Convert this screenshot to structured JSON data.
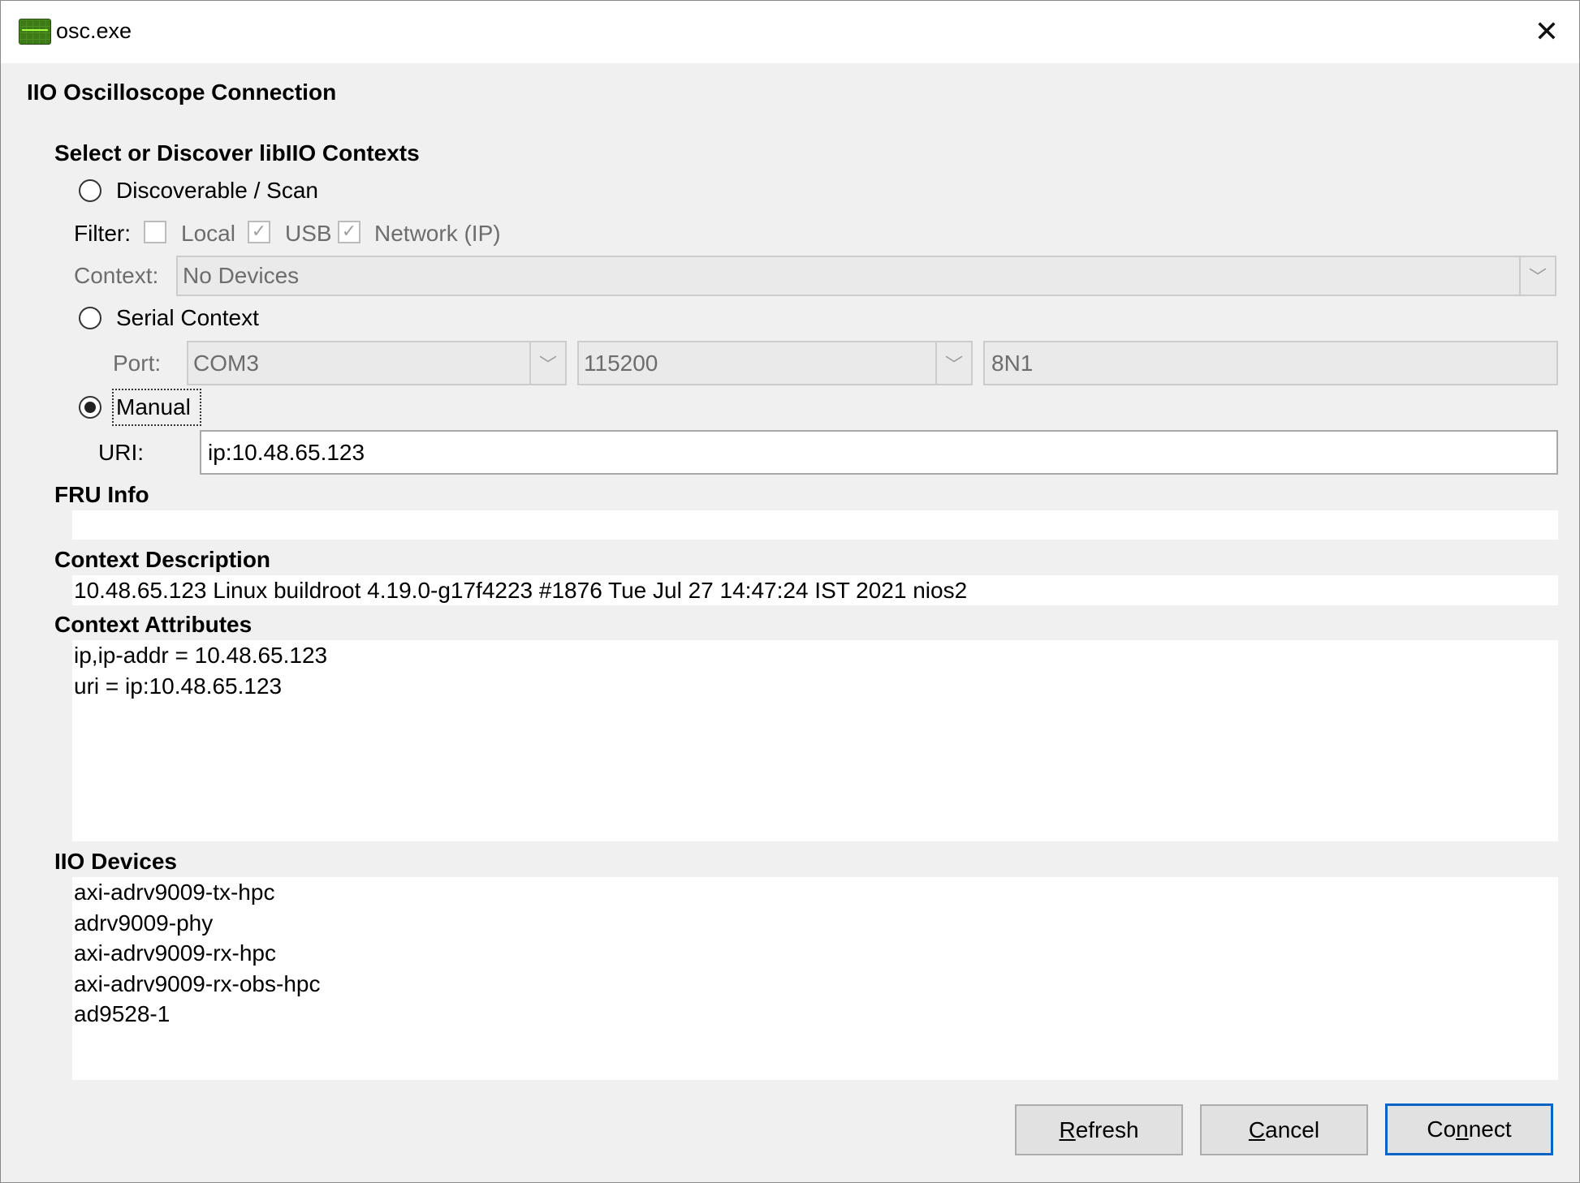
{
  "window": {
    "title": "osc.exe",
    "close_glyph": "✕"
  },
  "dialog": {
    "heading": "IIO Oscilloscope Connection"
  },
  "contexts": {
    "heading": "Select or Discover libIIO Contexts",
    "discoverable": {
      "label": "Discoverable / Scan",
      "selected": false
    },
    "filter": {
      "label": "Filter:",
      "local": {
        "label": "Local",
        "checked": false
      },
      "usb": {
        "label": "USB",
        "checked": true
      },
      "network": {
        "label": "Network (IP)",
        "checked": true
      }
    },
    "context_select": {
      "label": "Context:",
      "value": "No Devices"
    },
    "serial": {
      "label": "Serial Context",
      "selected": false,
      "port_label": "Port:",
      "port": "COM3",
      "baud": "115200",
      "config": "8N1"
    },
    "manual": {
      "label": "Manual",
      "selected": true,
      "uri_label": "URI:",
      "uri": "ip:10.48.65.123"
    }
  },
  "fru_info": {
    "heading": "FRU Info",
    "value": ""
  },
  "context_description": {
    "heading": "Context Description",
    "value": "10.48.65.123 Linux buildroot 4.19.0-g17f4223 #1876 Tue Jul 27 14:47:24 IST 2021 nios2"
  },
  "context_attributes": {
    "heading": "Context Attributes",
    "lines": [
      "ip,ip-addr = 10.48.65.123",
      "uri = ip:10.48.65.123"
    ]
  },
  "iio_devices": {
    "heading": "IIO Devices",
    "items": [
      "axi-adrv9009-tx-hpc",
      "adrv9009-phy",
      "axi-adrv9009-rx-hpc",
      "axi-adrv9009-rx-obs-hpc",
      "ad9528-1"
    ]
  },
  "buttons": {
    "refresh": {
      "label": "Refresh",
      "mnemonic_index": 0
    },
    "cancel": {
      "label": "Cancel",
      "mnemonic_index": 0
    },
    "connect": {
      "label": "Connect",
      "mnemonic_index": 2
    }
  },
  "icons": {
    "app": "oscilloscope-app-icon",
    "close": "close-icon",
    "dropdown": "chevron-down-icon",
    "check": "checkmark-icon"
  },
  "colors": {
    "default_button_border": "#0a63c7",
    "dialog_background": "#f0f0f0",
    "disabled_text": "#6d6d6d"
  }
}
